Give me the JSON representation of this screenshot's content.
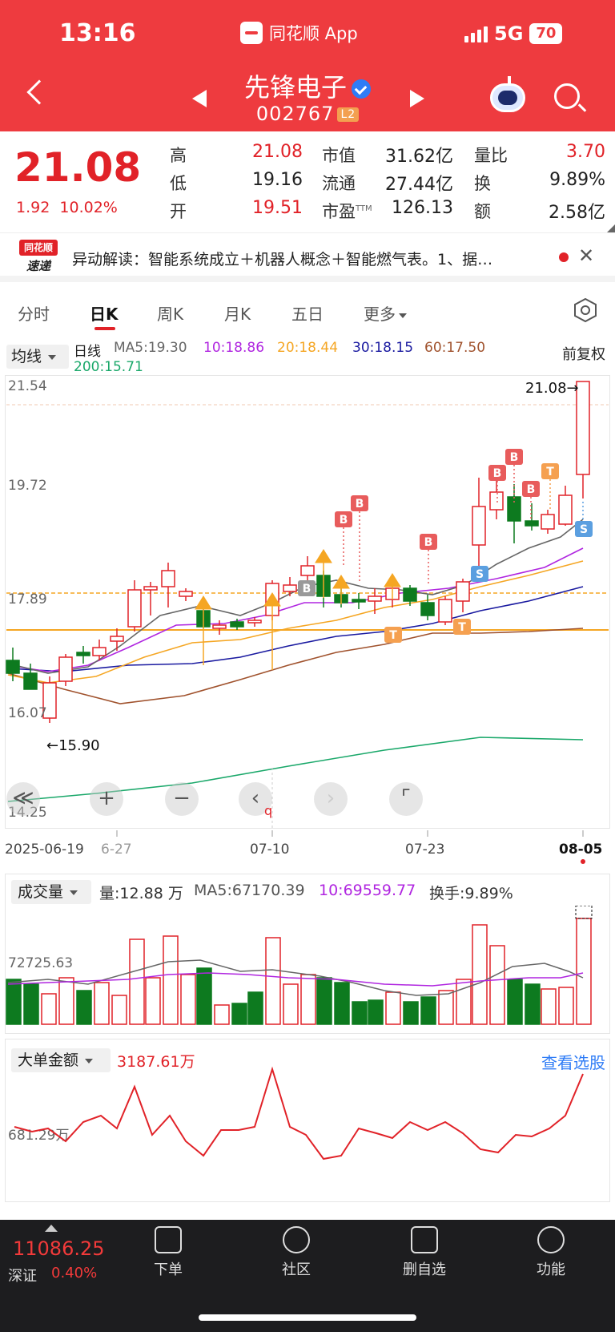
{
  "status": {
    "time": "13:16",
    "app_name": "同花顺 App",
    "network": "5G",
    "battery": "70"
  },
  "header": {
    "stock_name": "先锋电子",
    "stock_code": "002767",
    "level_badge": "L2"
  },
  "quote": {
    "price": "21.08",
    "change": "1.92",
    "change_pct": "10.02%",
    "high_label": "高",
    "high": "21.08",
    "low_label": "低",
    "low": "19.16",
    "open_label": "开",
    "open": "19.51",
    "mktcap_label": "市值",
    "mktcap": "31.62亿",
    "float_label": "流通",
    "float": "27.44亿",
    "pe_label": "市盈",
    "pe_sup": "TTM",
    "pe": "126.13",
    "vol_ratio_label": "量比",
    "vol_ratio": "3.70",
    "turnover_label": "换",
    "turnover": "9.89%",
    "amount_label": "额",
    "amount": "2.58亿"
  },
  "news": {
    "logo_top": "同花顺",
    "logo_bottom": "速递",
    "text": "异动解读：智能系统成立＋机器人概念＋智能燃气表。1、据…",
    "close": "✕"
  },
  "tabs": [
    {
      "label": "分时"
    },
    {
      "label": "日K"
    },
    {
      "label": "周K"
    },
    {
      "label": "月K"
    },
    {
      "label": "五日"
    },
    {
      "label": "更多"
    }
  ],
  "kline_header": {
    "indicator": "均线",
    "line_label": "日线",
    "ma5": "MA5:19.30",
    "ma10": "10:18.86",
    "ma20": "20:18.44",
    "ma30": "30:18.15",
    "ma60": "60:17.50",
    "ma200": "200:15.71",
    "adjust": "前复权",
    "colors": {
      "ma5": "#666666",
      "ma10": "#b026e0",
      "ma20": "#f5a623",
      "ma30": "#1a1aa0",
      "ma60": "#a0522d",
      "ma200": "#1aa86a",
      "up": "#e12228",
      "down": "#0d7a1f"
    }
  },
  "kline_axis": {
    "y_top": "21.54",
    "y_mid": "19.72",
    "y_low": "17.89",
    "y_bottom": "16.07",
    "y_min": "14.25",
    "high_marker": "21.08→",
    "low_marker": "←15.90"
  },
  "kline_dates": {
    "d1": "2025-06-19",
    "d2": "6-27",
    "d3": "07-10",
    "d4": "07-23",
    "d5": "08-05",
    "cursor_label": "q"
  },
  "kline_controls": {
    "collapse": "≪",
    "zoom_in": "+",
    "zoom_out": "−",
    "prev": "‹",
    "next": "›",
    "fullscreen": "⌜"
  },
  "signals": {
    "buy": "B",
    "sell": "S",
    "t": "T"
  },
  "volume": {
    "indicator": "成交量",
    "vol": "量:12.88 万",
    "ma5": "MA5:67170.39",
    "ma10": "10:69559.77",
    "turnover": "换手:9.89%",
    "axis_label": "72725.63"
  },
  "big_order": {
    "indicator": "大单金额",
    "value": "3187.61万",
    "axis_label": "681.29万",
    "link": "查看选股"
  },
  "bottom": {
    "index_value": "11086.25",
    "index_name": "深证",
    "index_change": "0.40%",
    "nav": [
      {
        "label": "下单"
      },
      {
        "label": "社区"
      },
      {
        "label": "删自选"
      },
      {
        "label": "功能"
      }
    ]
  }
}
